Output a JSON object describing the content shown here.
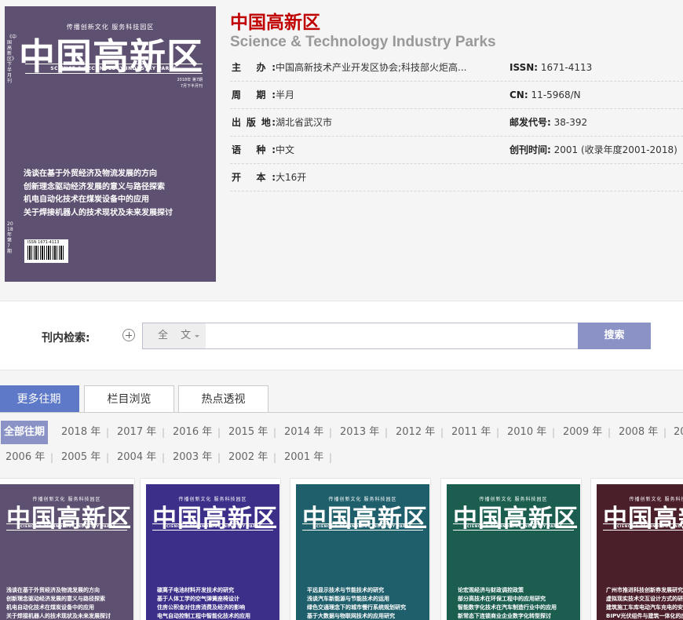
{
  "journal": {
    "title": "中国高新区",
    "english_title": "Science & Technology Industry Parks"
  },
  "cover": {
    "slogan": "传播创新文化  服务科技园区",
    "title": "中国高新区",
    "english": "SCIENCE & TECHNOLOGY INDUSTRY PARKS",
    "issue_line1": "2018年 第7期",
    "issue_line2": "7月下半月刊",
    "side_text": "《中国高新区》下半月刊",
    "side_bottom": "2018年第7期",
    "barcode_text": "ISSN 1671-4113",
    "headlines": [
      "浅谈在基于外贸经济及物流发展的方向",
      "创新理念驱动经济发展的意义与路径探索",
      "机电自动化技术在煤炭设备中的应用",
      "关于焊接机器人的技术现状及未来发展探讨"
    ]
  },
  "info": {
    "sponsor_label": "主    办:",
    "sponsor_value": "中国高新技术产业开发区协会;科技部火炬高...",
    "issn_label": "ISSN:",
    "issn_value": "1671-4113",
    "cycle_label": "周    期:",
    "cycle_value": "半月",
    "cn_label": "CN:",
    "cn_value": "11-5968/N",
    "place_label": "出 版 地:",
    "place_value": "湖北省武汉市",
    "postal_label": "邮发代号:",
    "postal_value": "38-392",
    "lang_label": "语    种:",
    "lang_value": "中文",
    "founded_label": "创刊时间:",
    "founded_value": "2001 (收录年度2001-2018)",
    "format_label": "开    本:",
    "format_value": "大16开"
  },
  "search": {
    "label": "刊内检索:",
    "scope": "全 文",
    "placeholder": "",
    "button": "搜索"
  },
  "tabs": [
    "更多往期",
    "栏目浏览",
    "热点透视"
  ],
  "years": {
    "all": "全部往期",
    "row1": [
      "2018 年",
      "2017 年",
      "2016 年",
      "2015 年",
      "2014 年",
      "2013 年",
      "2012 年",
      "2011 年",
      "2010 年",
      "2009 年",
      "2008 年",
      "20"
    ],
    "row2": [
      "2006 年",
      "2005 年",
      "2004 年",
      "2003 年",
      "2002 年",
      "2001 年"
    ]
  },
  "thumbs": [
    {
      "color": "#5d5070",
      "headlines": [
        "浅谈在基于外贸经济及物流发展的方向",
        "创新理念驱动经济发展的意义与路径探索",
        "机电自动化技术在煤炭设备中的应用",
        "关于焊接机器人的技术现状及未来发展探讨"
      ]
    },
    {
      "color": "#3c2f8a",
      "headlines": [
        "碳离子电池材料开发技术的研究",
        "基于人体工学的空气弹簧座椅设计",
        "住房公积金对住房消费及经济的影响",
        "电气自动控制工程中智能化技术的应用"
      ]
    },
    {
      "color": "#1f5f6b",
      "headlines": [
        "平远显示技术与节能技术的研究",
        "浅谈汽车新能源与节能技术的运用",
        "绿色交通理念下的城市慢行系统规划研究",
        "基于大数据与物联网技术的应用研究"
      ]
    },
    {
      "color": "#1b5e50",
      "headlines": [
        "论宏观经济与财政调控政策",
        "部分高技术在环保工程中的应用研究",
        "智能数字化技术在汽车制造行业中的应用",
        "新常态下连锁商业企业数字化转型探讨"
      ]
    },
    {
      "color": "#4a1f2a",
      "headlines": [
        "广州市推进科技创新券发展研究",
        "虚拟现实技术交互设计方式的研究",
        "建筑施工车库电动汽车充电的安全",
        "BIPV光伏组件与建筑一体化的应用"
      ]
    }
  ],
  "thumb_slogan": "传播创新文化  服务科技园区",
  "thumb_title": "中国高新区",
  "thumb_english": "SCIENCE & TECHNOLOGY INDUSTRY PARKS"
}
